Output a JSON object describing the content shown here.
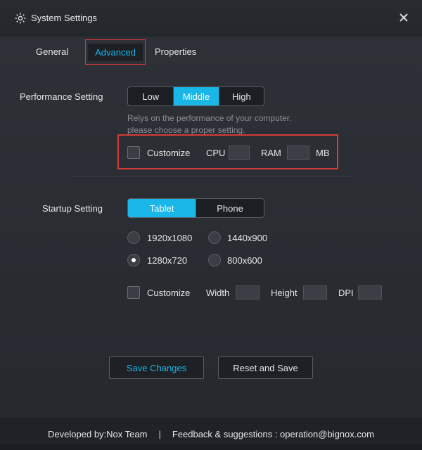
{
  "window": {
    "title": "System Settings",
    "icons": {
      "title": "gear-icon",
      "close": "close-icon"
    }
  },
  "tabs": [
    {
      "label": "General",
      "active": false
    },
    {
      "label": "Advanced",
      "active": true
    },
    {
      "label": "Properties",
      "active": false
    }
  ],
  "performance": {
    "label": "Performance Setting",
    "options": [
      "Low",
      "Middle",
      "High"
    ],
    "selected": "Middle",
    "hint_line1": "Relys on the performance of your computer.",
    "hint_line2": "please choose a proper setting.",
    "customize_label": "Customize",
    "cpu_label": "CPU",
    "ram_label": "RAM",
    "mb_label": "MB",
    "cpu_value": "",
    "ram_value": "",
    "customize_checked": false
  },
  "startup": {
    "label": "Startup Setting",
    "modes": [
      "Tablet",
      "Phone"
    ],
    "selected_mode": "Tablet",
    "resolutions": [
      {
        "label": "1920x1080",
        "checked": false
      },
      {
        "label": "1440x900",
        "checked": false
      },
      {
        "label": "1280x720",
        "checked": true
      },
      {
        "label": "800x600",
        "checked": false
      }
    ],
    "customize_label": "Customize",
    "width_label": "Width",
    "height_label": "Height",
    "dpi_label": "DPI",
    "customize_checked": false
  },
  "actions": {
    "save_label": "Save Changes",
    "reset_label": "Reset and Save"
  },
  "footer": {
    "developed_by": "Developed by:Nox Team",
    "separator": "|",
    "feedback": "Feedback & suggestions : operation@bignox.com"
  },
  "colors": {
    "accent": "#19b6e8",
    "highlight_border": "#d23a3a"
  }
}
